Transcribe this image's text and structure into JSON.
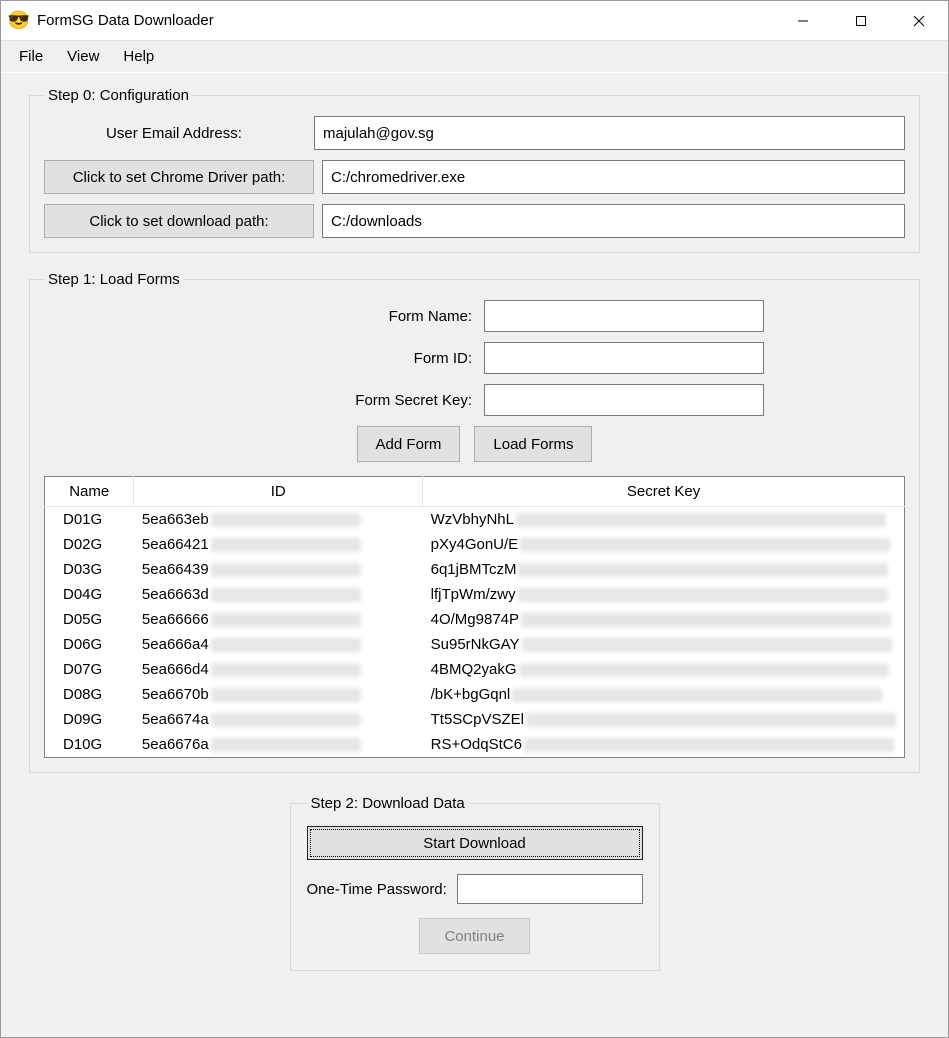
{
  "window": {
    "title": "FormSG Data Downloader"
  },
  "menu": {
    "file": "File",
    "view": "View",
    "help": "Help"
  },
  "step0": {
    "legend": "Step 0: Configuration",
    "email_label": "User Email Address:",
    "email_value": "majulah@gov.sg",
    "chrome_btn": "Click to set Chrome Driver path:",
    "chrome_value": "C:/chromedriver.exe",
    "download_btn": "Click to set download path:",
    "download_value": "C:/downloads"
  },
  "step1": {
    "legend": "Step 1: Load Forms",
    "form_name_label": "Form Name:",
    "form_name_value": "",
    "form_id_label": "Form ID:",
    "form_id_value": "",
    "form_secret_label": "Form Secret Key:",
    "form_secret_value": "",
    "add_btn": "Add Form",
    "load_btn": "Load Forms",
    "columns": {
      "name": "Name",
      "id": "ID",
      "secret": "Secret Key"
    },
    "rows": [
      {
        "name": "D01G",
        "id": "5ea663eb",
        "secret": "WzVbhyNhL"
      },
      {
        "name": "D02G",
        "id": "5ea66421",
        "secret": "pXy4GonU/E"
      },
      {
        "name": "D03G",
        "id": "5ea66439",
        "secret": "6q1jBMTczM"
      },
      {
        "name": "D04G",
        "id": "5ea6663d",
        "secret": "lfjTpWm/zwy"
      },
      {
        "name": "D05G",
        "id": "5ea66666",
        "secret": "4O/Mg9874P"
      },
      {
        "name": "D06G",
        "id": "5ea666a4",
        "secret": "Su95rNkGAY"
      },
      {
        "name": "D07G",
        "id": "5ea666d4",
        "secret": "4BMQ2yakG"
      },
      {
        "name": "D08G",
        "id": "5ea6670b",
        "secret": "/bK+bgGqnl"
      },
      {
        "name": "D09G",
        "id": "5ea6674a",
        "secret": "Tt5SCpVSZEl"
      },
      {
        "name": "D10G",
        "id": "5ea6676a",
        "secret": "RS+OdqStC6"
      }
    ]
  },
  "step2": {
    "legend": "Step 2: Download Data",
    "start_btn": "Start Download",
    "otp_label": "One-Time Password:",
    "otp_value": "",
    "continue_btn": "Continue"
  }
}
